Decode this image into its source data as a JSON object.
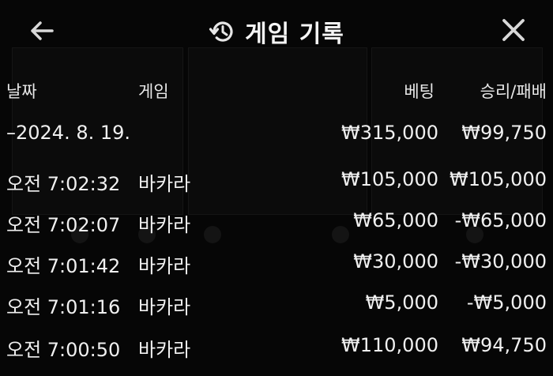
{
  "header": {
    "title": "게임 기록",
    "back_icon": "arrow-left-icon",
    "history_icon": "history-clock-icon",
    "close_icon": "close-icon"
  },
  "columns": {
    "date": "날짜",
    "game": "게임",
    "bet": "베팅",
    "win_loss": "승리/패배"
  },
  "summary": {
    "date": "–2024. 8. 19.",
    "bet": "₩315,000",
    "win_loss": "₩99,750"
  },
  "rows": [
    {
      "time": "오전 7:02:32",
      "game": "바카라",
      "bet": "₩105,000",
      "win_loss": "₩105,000"
    },
    {
      "time": "오전 7:02:07",
      "game": "바카라",
      "bet": "₩65,000",
      "win_loss": "-₩65,000"
    },
    {
      "time": "오전 7:01:42",
      "game": "바카라",
      "bet": "₩30,000",
      "win_loss": "-₩30,000"
    },
    {
      "time": "오전 7:01:16",
      "game": "바카라",
      "bet": "₩5,000",
      "win_loss": "-₩5,000"
    },
    {
      "time": "오전 7:00:50",
      "game": "바카라",
      "bet": "₩110,000",
      "win_loss": "₩94,750"
    }
  ]
}
